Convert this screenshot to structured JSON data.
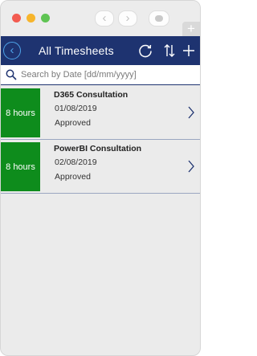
{
  "browser": {
    "back_glyph": "‹",
    "forward_glyph": "›",
    "new_tab_glyph": "+"
  },
  "header": {
    "title": "All Timesheets",
    "back_glyph": "‹",
    "accent": "#4ea3e8",
    "background": "#1e3370"
  },
  "search": {
    "placeholder": "Search by Date [dd/mm/yyyy]",
    "value": ""
  },
  "timesheets": [
    {
      "hours": "8 hours",
      "title": "D365 Consultation",
      "date": "01/08/2019",
      "status": "Approved"
    },
    {
      "hours": "8 hours",
      "title": "PowerBI Consultation",
      "date": "02/08/2019",
      "status": "Approved"
    }
  ],
  "colors": {
    "hours_badge": "#0e8c1c",
    "list_background": "#ebebeb"
  },
  "icons": {
    "refresh": "refresh-icon",
    "sort": "sort-icon",
    "add": "add-icon",
    "search": "search-icon",
    "chevron": "chevron-right-icon"
  }
}
